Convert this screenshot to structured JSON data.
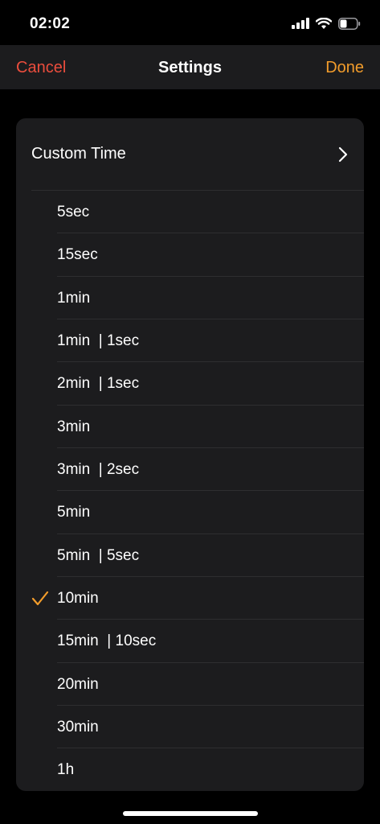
{
  "status": {
    "time": "02:02"
  },
  "nav": {
    "cancel_label": "Cancel",
    "title": "Settings",
    "done_label": "Done"
  },
  "custom": {
    "label": "Custom Time"
  },
  "options": [
    {
      "label": "5sec",
      "selected": false
    },
    {
      "label": "15sec",
      "selected": false
    },
    {
      "label": "1min",
      "selected": false
    },
    {
      "label": "1min  | 1sec",
      "selected": false
    },
    {
      "label": "2min  | 1sec",
      "selected": false
    },
    {
      "label": "3min",
      "selected": false
    },
    {
      "label": "3min  | 2sec",
      "selected": false
    },
    {
      "label": "5min",
      "selected": false
    },
    {
      "label": "5min  | 5sec",
      "selected": false
    },
    {
      "label": "10min",
      "selected": true
    },
    {
      "label": "15min  | 10sec",
      "selected": false
    },
    {
      "label": "20min",
      "selected": false
    },
    {
      "label": "30min",
      "selected": false
    },
    {
      "label": "1h",
      "selected": false
    }
  ],
  "colors": {
    "cancel": "#eb4d3d",
    "done": "#f29c2b",
    "check": "#f29c2b",
    "chevron": "#ffffff"
  },
  "icons": {
    "signal": "cellular-signal-icon",
    "wifi": "wifi-icon",
    "battery": "battery-icon",
    "chevron": "chevron-right-icon",
    "check": "checkmark-icon"
  }
}
